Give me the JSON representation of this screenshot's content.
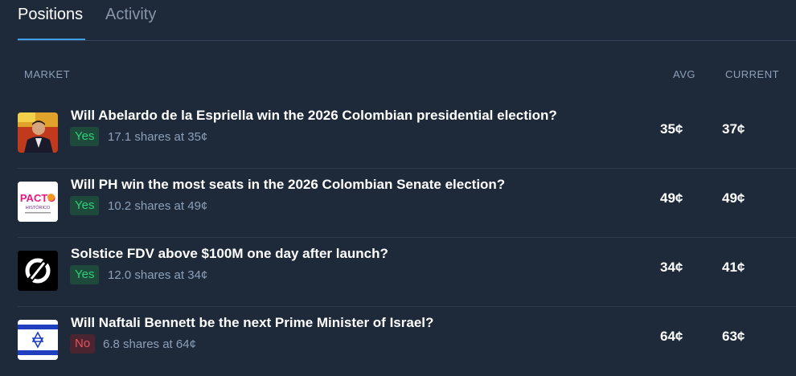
{
  "tabs": [
    {
      "label": "Positions",
      "active": true
    },
    {
      "label": "Activity",
      "active": false
    }
  ],
  "columns": {
    "market": "MARKET",
    "avg": "AVG",
    "current": "CURRENT"
  },
  "positions": [
    {
      "title": "Will Abelardo de la Espriella win the 2026 Colombian presidential election?",
      "outcome": "Yes",
      "shares": "17.1 shares at 35¢",
      "avg": "35¢",
      "current": "37¢",
      "icon": "candidate-portrait-icon"
    },
    {
      "title": "Will PH win the most seats in the 2026 Colombian Senate election?",
      "outcome": "Yes",
      "shares": "10.2 shares at 49¢",
      "avg": "49¢",
      "current": "49¢",
      "icon": "pacto-historico-logo-icon",
      "logo_text": "PACTO",
      "logo_subtext": "HISTÓRICO"
    },
    {
      "title": "Solstice FDV above $100M one day after launch?",
      "outcome": "Yes",
      "shares": "12.0 shares at 34¢",
      "avg": "34¢",
      "current": "41¢",
      "icon": "solstice-logo-icon"
    },
    {
      "title": "Will Naftali Bennett be the next Prime Minister of Israel?",
      "outcome": "No",
      "shares": "6.8 shares at 64¢",
      "avg": "64¢",
      "current": "63¢",
      "icon": "israel-flag-icon"
    }
  ],
  "colors": {
    "background": "#1e2a3a",
    "tab_accent": "#3e9fe6",
    "yes_text": "#2fcf7a",
    "yes_bg": "#1d4a3a",
    "no_text": "#e4525b",
    "no_bg": "#4a2530",
    "muted": "#8da0b8"
  }
}
